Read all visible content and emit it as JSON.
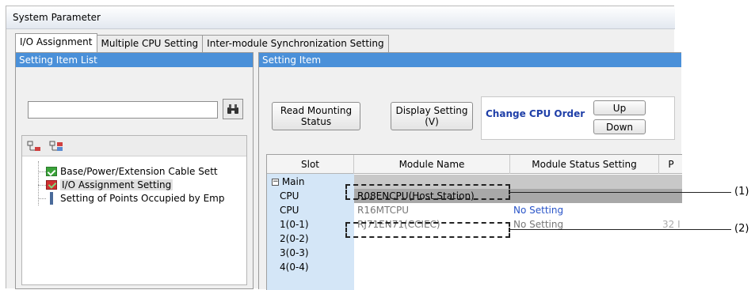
{
  "window": {
    "title": "System Parameter"
  },
  "tabs": [
    {
      "label": "I/O Assignment",
      "active": true
    },
    {
      "label": "Multiple CPU Setting",
      "active": false
    },
    {
      "label": "Inter-module Synchronization Setting",
      "active": false
    }
  ],
  "left_pane": {
    "header": "Setting Item List",
    "search": {
      "value": "",
      "placeholder": ""
    },
    "search_icon": "binoculars-icon",
    "tree": [
      {
        "label": "Base/Power/Extension Cable Sett",
        "icon": "check-icon"
      },
      {
        "label": "I/O Assignment Setting",
        "icon": "check-icon-error",
        "selected": true
      },
      {
        "label": "Setting of Points Occupied by Emp",
        "icon": "bar-icon"
      }
    ]
  },
  "right_pane": {
    "header": "Setting Item",
    "read_mounting_status": {
      "line1": "Read Mounting",
      "line2": "Status"
    },
    "display_setting": {
      "line1": "Display Setting",
      "line2": "(V)"
    },
    "change_cpu_order": {
      "label": "Change CPU Order",
      "up": "Up",
      "down": "Down"
    }
  },
  "grid": {
    "columns": [
      "Slot",
      "Module Name",
      "Module Status Setting",
      "P"
    ],
    "group": "Main",
    "rows": [
      {
        "slot": "CPU",
        "module": "R08ENCPU(Host Station)",
        "status": "",
        "p": ""
      },
      {
        "slot": "CPU",
        "module": "R16MTCPU",
        "status": "No Setting",
        "p": ""
      },
      {
        "slot": "1(0-1)",
        "module": "RJ71EN71(CCIEC)",
        "status": "No Setting",
        "p": "32 I"
      },
      {
        "slot": "2(0-2)",
        "module": "",
        "status": "",
        "p": ""
      },
      {
        "slot": "3(0-3)",
        "module": "",
        "status": "",
        "p": ""
      },
      {
        "slot": "4(0-4)",
        "module": "",
        "status": "",
        "p": ""
      }
    ]
  },
  "callouts": [
    "(1)",
    "(2)"
  ],
  "colors": {
    "header_blue": "#4a90d9",
    "slot_blue": "#d4e6f7",
    "cpu_order_blue": "#1f3fa8",
    "status_blue": "#2a55c8"
  }
}
